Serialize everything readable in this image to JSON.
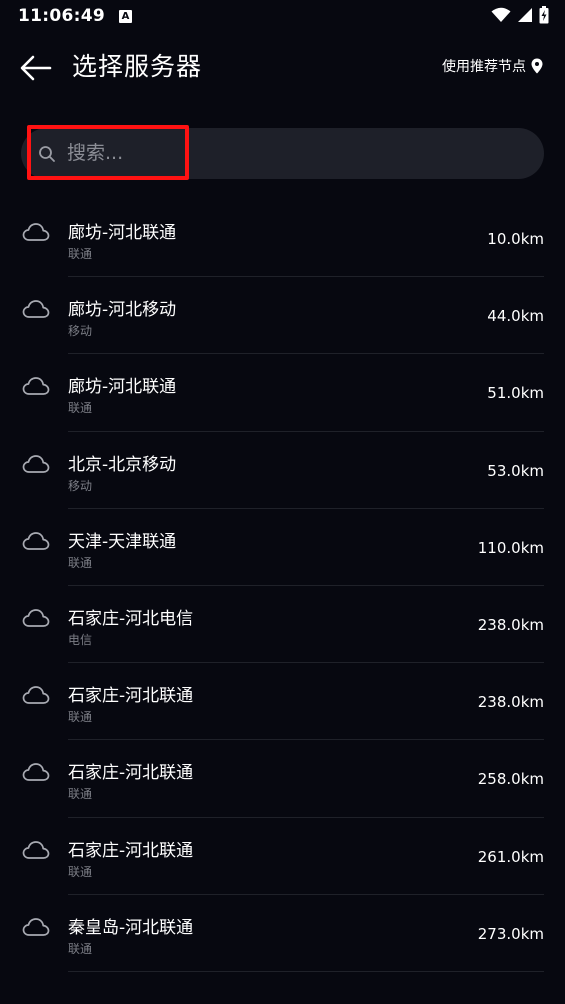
{
  "status": {
    "time": "11:06:49",
    "notif_letter": "A"
  },
  "header": {
    "title": "选择服务器",
    "recommend_label": "使用推荐节点"
  },
  "search": {
    "placeholder": "搜索..."
  },
  "servers": [
    {
      "name": "廊坊-河北联通",
      "isp": "联通",
      "distance": "10.0km"
    },
    {
      "name": "廊坊-河北移动",
      "isp": "移动",
      "distance": "44.0km"
    },
    {
      "name": "廊坊-河北联通",
      "isp": "联通",
      "distance": "51.0km"
    },
    {
      "name": "北京-北京移动",
      "isp": "移动",
      "distance": "53.0km"
    },
    {
      "name": "天津-天津联通",
      "isp": "联通",
      "distance": "110.0km"
    },
    {
      "name": "石家庄-河北电信",
      "isp": "电信",
      "distance": "238.0km"
    },
    {
      "name": "石家庄-河北联通",
      "isp": "联通",
      "distance": "238.0km"
    },
    {
      "name": "石家庄-河北联通",
      "isp": "联通",
      "distance": "258.0km"
    },
    {
      "name": "石家庄-河北联通",
      "isp": "联通",
      "distance": "261.0km"
    },
    {
      "name": "秦皇岛-河北联通",
      "isp": "联通",
      "distance": "273.0km"
    }
  ],
  "colors": {
    "background": "#070810",
    "search_bg": "#1e2029",
    "highlight": "#ff1212",
    "muted_text": "#7b7d85"
  }
}
